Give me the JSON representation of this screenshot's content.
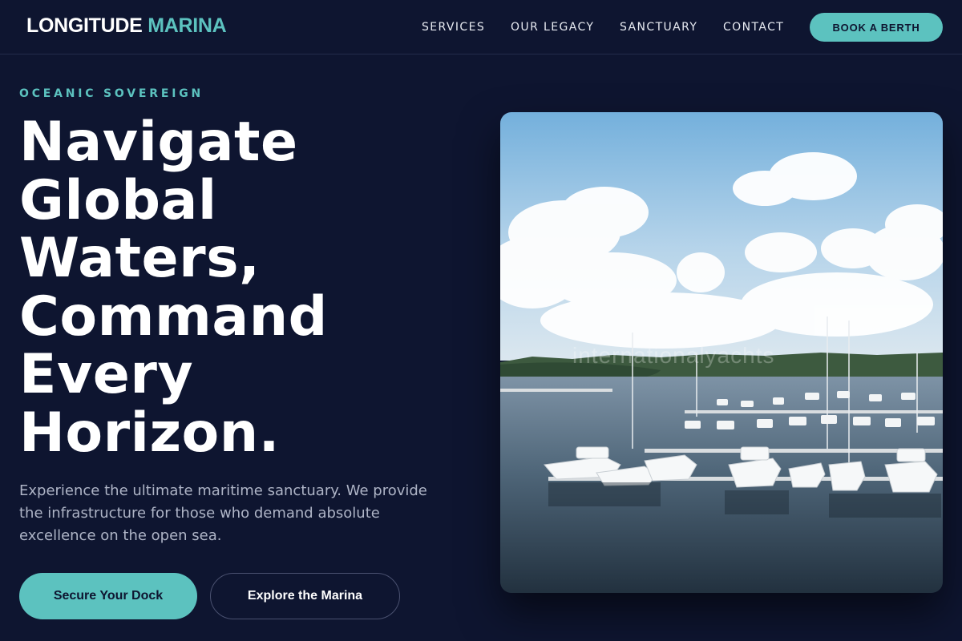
{
  "header": {
    "logo_main": "LONGITUDE",
    "logo_accent": "MARINA",
    "nav": [
      "SERVICES",
      "OUR LEGACY",
      "SANCTUARY",
      "CONTACT"
    ],
    "cta_label": "BOOK A BERTH"
  },
  "hero": {
    "eyebrow": "OCEANIC SOVEREIGN",
    "headline_lines": [
      "Navigate",
      "Global",
      "Waters,",
      "Command",
      "Every",
      "Horizon."
    ],
    "lede": "Experience the ultimate maritime sanctuary. We provide the infrastructure for those who demand absolute excellence on the open sea.",
    "primary_button": "Secure Your Dock",
    "secondary_button": "Explore the Marina",
    "image_watermark": "internationalyachts"
  },
  "colors": {
    "background": "#0e1530",
    "accent": "#5cc2bf",
    "text": "#ffffff",
    "muted_text": "#aeb4c6"
  }
}
